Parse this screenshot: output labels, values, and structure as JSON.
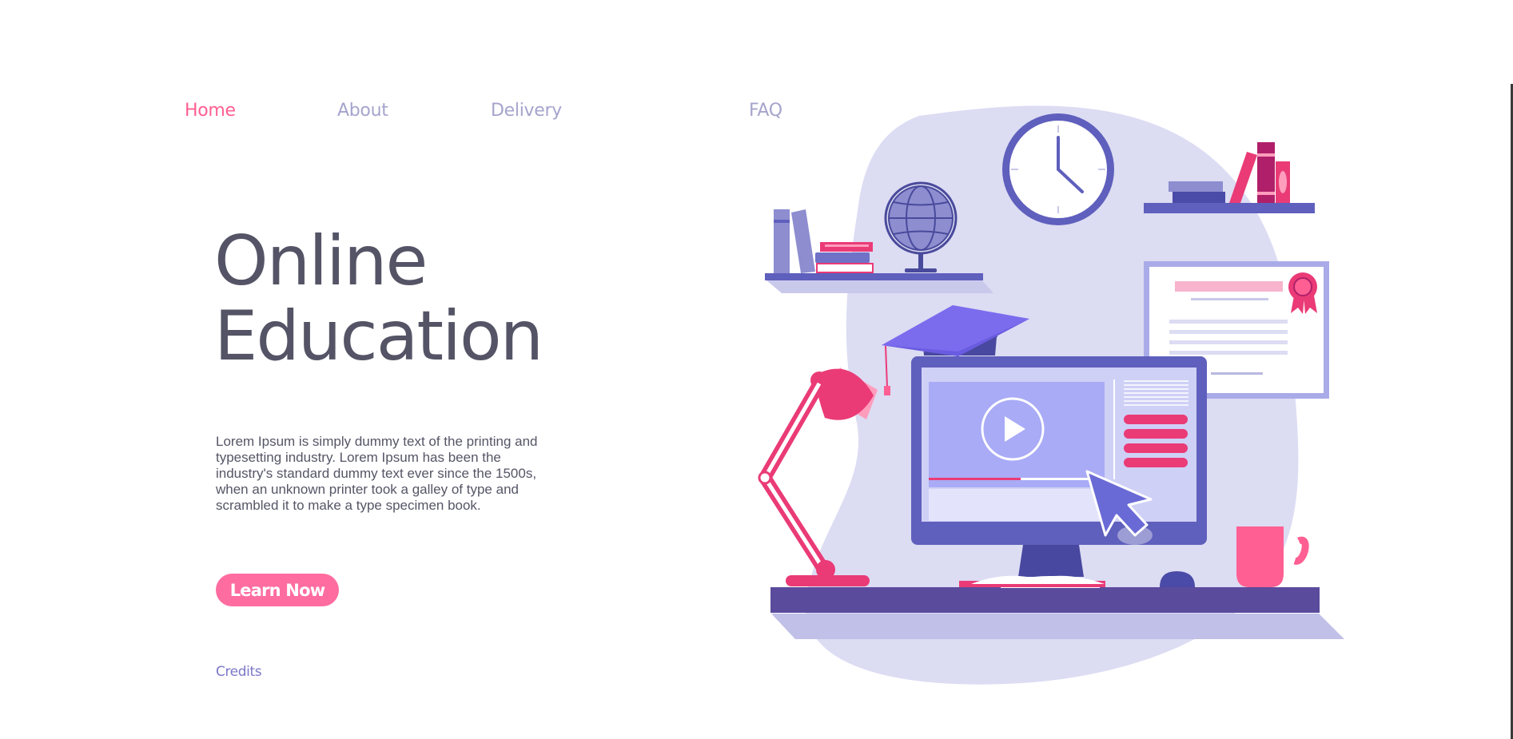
{
  "nav": {
    "items": [
      {
        "label": "Home",
        "active": true
      },
      {
        "label": "About",
        "active": false
      },
      {
        "label": "Delivery",
        "active": false
      },
      {
        "label": "FAQ",
        "active": false
      }
    ]
  },
  "hero": {
    "title_line1": "Online",
    "title_line2": "Education",
    "body": "Lorem Ipsum is simply dummy text of the printing and typesetting industry. Lorem Ipsum has been the industry's standard dummy text ever since the 1500s, when an unknown printer took a galley of type and scrambled it to make a type specimen book.",
    "cta_label": "Learn Now"
  },
  "footer": {
    "credits_label": "Credits"
  },
  "colors": {
    "accent_pink": "#ff6da0",
    "nav_inactive": "#a5a4cc",
    "title": "#545466",
    "illustration_purple": "#5f5fbd",
    "illustration_blob": "#dcdcf3"
  },
  "illustration": {
    "icons": [
      "clock-icon",
      "globe-icon",
      "graduation-cap-icon",
      "desk-lamp-icon",
      "computer-monitor-icon",
      "play-icon",
      "cursor-arrow-icon",
      "certificate-icon",
      "award-ribbon-icon",
      "coffee-mug-icon",
      "computer-mouse-icon",
      "books-icon",
      "open-book-icon"
    ]
  }
}
